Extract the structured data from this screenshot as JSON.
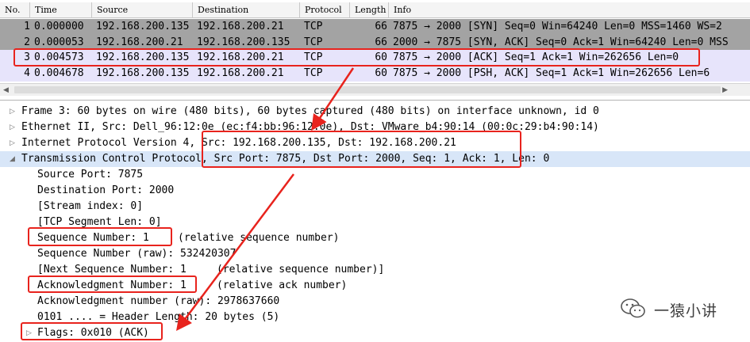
{
  "packet_list": {
    "columns": [
      "No.",
      "Time",
      "Source",
      "Destination",
      "Protocol",
      "Length",
      "Info"
    ],
    "rows": [
      {
        "no": "1",
        "time": "0.000000",
        "src": "192.168.200.135",
        "dst": "192.168.200.21",
        "proto": "TCP",
        "len": "66",
        "info": "7875 → 2000 [SYN] Seq=0 Win=64240 Len=0 MSS=1460 WS=2"
      },
      {
        "no": "2",
        "time": "0.000053",
        "src": "192.168.200.21",
        "dst": "192.168.200.135",
        "proto": "TCP",
        "len": "66",
        "info": "2000 → 7875 [SYN, ACK] Seq=0 Ack=1 Win=64240 Len=0 MSS"
      },
      {
        "no": "3",
        "time": "0.004573",
        "src": "192.168.200.135",
        "dst": "192.168.200.21",
        "proto": "TCP",
        "len": "60",
        "info": "7875 → 2000 [ACK] Seq=1 Ack=1 Win=262656 Len=0"
      },
      {
        "no": "4",
        "time": "0.004678",
        "src": "192.168.200.135",
        "dst": "192.168.200.21",
        "proto": "TCP",
        "len": "60",
        "info": "7875 → 2000 [PSH, ACK] Seq=1 Ack=1 Win=262656 Len=6"
      }
    ]
  },
  "details": {
    "frame": "Frame 3: 60 bytes on wire (480 bits), 60 bytes captured (480 bits) on interface unknown, id 0",
    "ethernet": "Ethernet II, Src: Dell_96:12:0e (ec:f4:bb:96:12:0e), Dst: VMware_b4:90:14 (00:0c:29:b4:90:14)",
    "ip": "Internet Protocol Version 4, Src: 192.168.200.135, Dst: 192.168.200.21",
    "tcp": "Transmission Control Protocol, Src Port: 7875, Dst Port: 2000, Seq: 1, Ack: 1, Len: 0",
    "source_port": "Source Port: 7875",
    "destination_port": "Destination Port: 2000",
    "stream_index": "[Stream index: 0]",
    "segment_len": "[TCP Segment Len: 0]",
    "seq_number": "Sequence Number: 1",
    "seq_note": "(relative sequence number)",
    "seq_raw": "Sequence Number (raw): 532420307",
    "next_seq": "[Next Sequence Number: 1",
    "next_seq_note": "(relative sequence number)]",
    "ack_number": "Acknowledgment Number: 1",
    "ack_note": "(relative ack number)",
    "ack_raw": "Acknowledgment number (raw): 2978637660",
    "header_len": "0101 .... = Header Length: 20 bytes (5)",
    "flags": "Flags: 0x010 (ACK)"
  },
  "watermark": {
    "text": "一猿小讲",
    "icon": "wechat-icon"
  },
  "colors": {
    "annotation_red": "#e8231d",
    "row_gray": "#a3a3a3",
    "row_lavender": "#e7e4fb",
    "selected_line": "#d8e6f8"
  }
}
